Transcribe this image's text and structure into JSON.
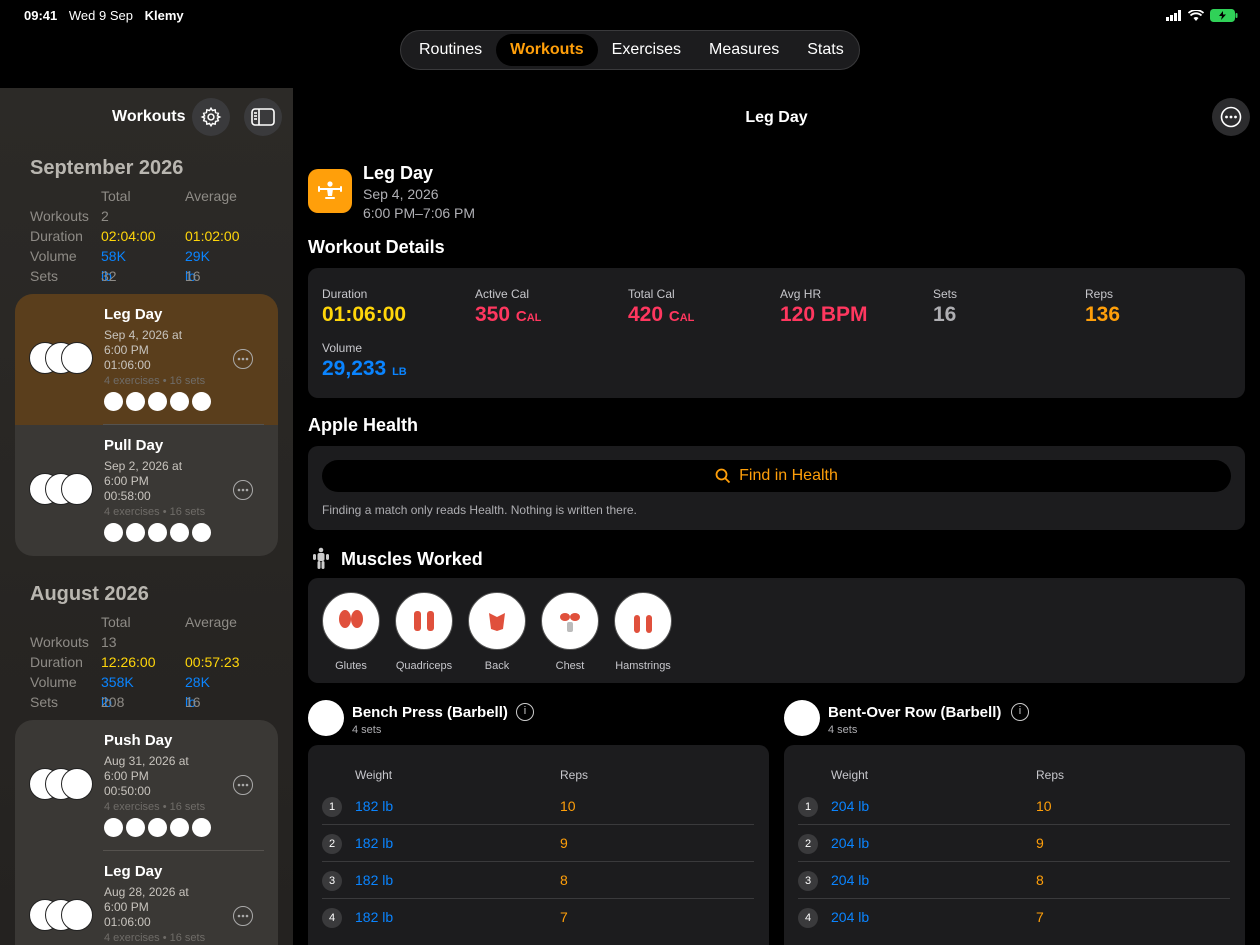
{
  "status": {
    "time": "09:41",
    "date": "Wed 9 Sep",
    "carrier": "Klemy"
  },
  "tabs": [
    "Routines",
    "Workouts",
    "Exercises",
    "Measures",
    "Stats"
  ],
  "active_tab": "Workouts",
  "sidebar": {
    "title": "Workouts",
    "months": [
      {
        "title": "September 2026",
        "col_total": "Total",
        "col_avg": "Average",
        "workouts_label": "Workouts",
        "workouts_total": "2",
        "duration_label": "Duration",
        "duration_total": "02:04:00",
        "duration_avg": "01:02:00",
        "volume_label": "Volume",
        "volume_total": "58K lb",
        "volume_avg": "29K lb",
        "sets_label": "Sets",
        "sets_total": "32",
        "sets_avg": "16",
        "workouts": [
          {
            "name": "Leg Day",
            "date": "Sep 4, 2026 at 6:00 PM",
            "duration": "01:06:00",
            "summary": "4 exercises • 16 sets"
          },
          {
            "name": "Pull Day",
            "date": "Sep 2, 2026 at 6:00 PM",
            "duration": "00:58:00",
            "summary": "4 exercises • 16 sets"
          }
        ]
      },
      {
        "title": "August 2026",
        "col_total": "Total",
        "col_avg": "Average",
        "workouts_label": "Workouts",
        "workouts_total": "13",
        "duration_label": "Duration",
        "duration_total": "12:26:00",
        "duration_avg": "00:57:23",
        "volume_label": "Volume",
        "volume_total": "358K lb",
        "volume_avg": "28K lb",
        "sets_label": "Sets",
        "sets_total": "208",
        "sets_avg": "16",
        "workouts": [
          {
            "name": "Push Day",
            "date": "Aug 31, 2026 at 6:00 PM",
            "duration": "00:50:00",
            "summary": "4 exercises • 16 sets"
          },
          {
            "name": "Leg Day",
            "date": "Aug 28, 2026 at 6:00 PM",
            "duration": "01:06:00",
            "summary": "4 exercises • 16 sets"
          }
        ]
      }
    ]
  },
  "main": {
    "nav_title": "Leg Day",
    "header": {
      "name": "Leg Day",
      "date": "Sep 4, 2026",
      "time": "6:00 PM–7:06 PM"
    },
    "details_title": "Workout Details",
    "metrics": {
      "duration_label": "Duration",
      "duration_value": "01:06:00",
      "active_label": "Active Cal",
      "active_value": "350",
      "active_unit": "Cal",
      "total_label": "Total Cal",
      "total_value": "420",
      "total_unit": "Cal",
      "hr_label": "Avg HR",
      "hr_value": "120 BPM",
      "sets_label": "Sets",
      "sets_value": "16",
      "reps_label": "Reps",
      "reps_value": "136",
      "volume_label": "Volume",
      "volume_value": "29,233",
      "volume_unit": "lb"
    },
    "health_title": "Apple Health",
    "find_label": "Find in Health",
    "health_note": "Finding a match only reads Health. Nothing is written there.",
    "muscles_title": "Muscles Worked",
    "muscles": [
      "Glutes",
      "Quadriceps",
      "Back",
      "Chest",
      "Hamstrings"
    ],
    "exercises": [
      {
        "name": "Bench Press (Barbell)",
        "sets_label": "4 sets",
        "col_weight": "Weight",
        "col_reps": "Reps",
        "rows": [
          {
            "n": "1",
            "w": "182 lb",
            "r": "10"
          },
          {
            "n": "2",
            "w": "182 lb",
            "r": "9"
          },
          {
            "n": "3",
            "w": "182 lb",
            "r": "8"
          },
          {
            "n": "4",
            "w": "182 lb",
            "r": "7"
          }
        ]
      },
      {
        "name": "Bent-Over Row (Barbell)",
        "sets_label": "4 sets",
        "col_weight": "Weight",
        "col_reps": "Reps",
        "rows": [
          {
            "n": "1",
            "w": "204 lb",
            "r": "10"
          },
          {
            "n": "2",
            "w": "204 lb",
            "r": "9"
          },
          {
            "n": "3",
            "w": "204 lb",
            "r": "8"
          },
          {
            "n": "4",
            "w": "204 lb",
            "r": "7"
          }
        ]
      }
    ]
  },
  "colors": {
    "accent": "#ff9f0a",
    "blue": "#0a84ff",
    "yellow": "#ffd60a",
    "red": "#ff375f"
  }
}
